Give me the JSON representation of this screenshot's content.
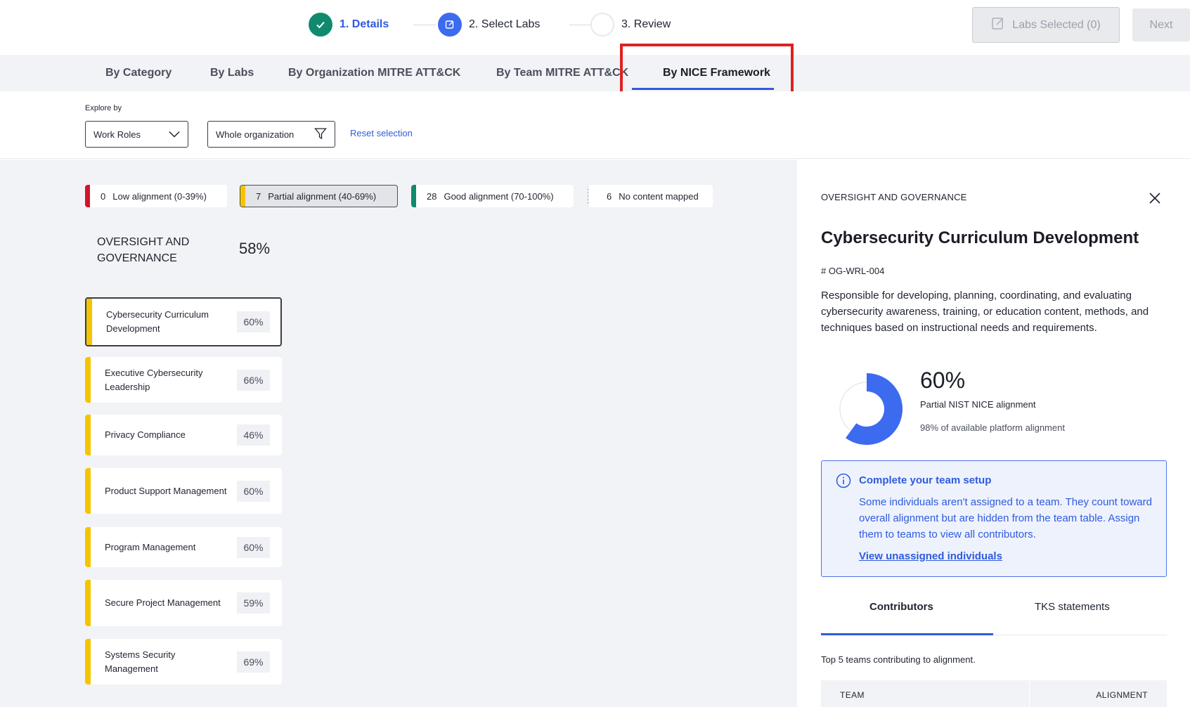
{
  "stepper": {
    "step1": "1. Details",
    "step2": "2. Select Labs",
    "step3": "3. Review"
  },
  "header": {
    "labs_selected": "Labs Selected (0)",
    "next": "Next"
  },
  "tabs": [
    {
      "label": "By Category"
    },
    {
      "label": "By Labs"
    },
    {
      "label": "By Organization MITRE ATT&CK"
    },
    {
      "label": "By Team MITRE ATT&CK"
    },
    {
      "label": "By NICE Framework"
    }
  ],
  "explore": {
    "label": "Explore by",
    "select_value": "Work Roles",
    "filter_value": "Whole organization",
    "reset": "Reset selection"
  },
  "legend": [
    {
      "count": "0",
      "label": "Low alignment (0-39%)",
      "color": "#d0142c"
    },
    {
      "count": "7",
      "label": "Partial alignment (40-69%)",
      "color": "#f5c400"
    },
    {
      "count": "28",
      "label": "Good alignment (70-100%)",
      "color": "#0f8a6e"
    },
    {
      "count": "6",
      "label": "No content mapped",
      "color": "#ffffff"
    }
  ],
  "group": {
    "title_line1": "OVERSIGHT AND",
    "title_line2": "GOVERNANCE",
    "percent": "58%"
  },
  "roles": [
    {
      "name": "Cybersecurity Curriculum Development",
      "percent": "60%"
    },
    {
      "name": "Executive Cybersecurity Leadership",
      "percent": "66%"
    },
    {
      "name": "Privacy Compliance",
      "percent": "46%"
    },
    {
      "name": "Product Support Management",
      "percent": "60%"
    },
    {
      "name": "Program Management",
      "percent": "60%"
    },
    {
      "name": "Secure Project Management",
      "percent": "59%"
    },
    {
      "name": "Systems Security Management",
      "percent": "69%"
    }
  ],
  "panel": {
    "eyebrow": "OVERSIGHT AND GOVERNANCE",
    "title": "Cybersecurity Curriculum Development",
    "code": "# OG-WRL-004",
    "description": "Responsible for developing, planning, coordinating, and evaluating cybersecurity awareness, training, or education content, methods, and techniques based on instructional needs and requirements.",
    "percent": "60%",
    "alignment_value": 0.6,
    "alignment_label": "Partial NIST NICE alignment",
    "platform_label": "98% of available platform alignment",
    "info_title": "Complete your team setup",
    "info_text": "Some individuals aren't assigned to a team. They count toward overall alignment but are hidden from the team table. Assign them to teams to view all contributors.",
    "info_link": "View unassigned individuals",
    "tab_contributors": "Contributors",
    "tab_tks": "TKS statements",
    "top_teams": "Top 5 teams contributing to alignment.",
    "th_team": "TEAM",
    "th_alignment": "ALIGNMENT"
  },
  "colors": {
    "accent": "#2f5bdc",
    "success": "#0f8a6e",
    "partial": "#f5c400",
    "low": "#d0142c",
    "highlight": "#e02020"
  }
}
